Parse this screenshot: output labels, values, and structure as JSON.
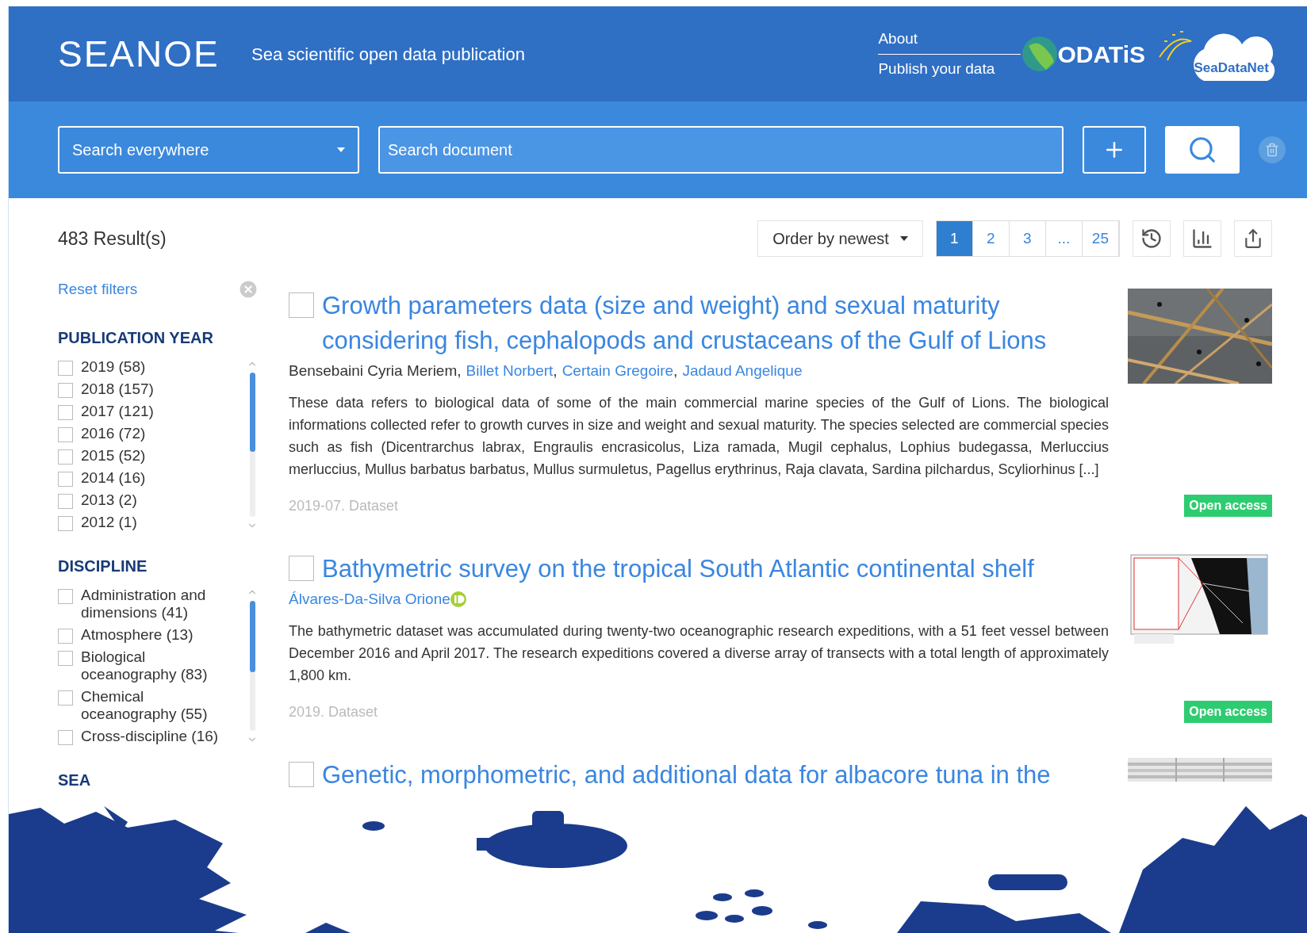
{
  "header": {
    "logo": "SEANOE",
    "tagline": "Sea scientific open data publication",
    "links": [
      "About",
      "Publish your data"
    ],
    "partner_logos": [
      "ODATiS",
      "SeaDataNet"
    ]
  },
  "search": {
    "scope": "Search everywhere",
    "placeholder": "Search document"
  },
  "results_count": "483 Result(s)",
  "reset_filters": "Reset filters",
  "facets": [
    {
      "title": "PUBLICATION YEAR",
      "items": [
        {
          "label": "2019 (58)",
          "checked": false
        },
        {
          "label": "2018 (157)",
          "checked": false
        },
        {
          "label": "2017 (121)",
          "checked": false
        },
        {
          "label": "2016 (72)",
          "checked": false
        },
        {
          "label": "2015 (52)",
          "checked": false
        },
        {
          "label": "2014 (16)",
          "checked": false
        },
        {
          "label": "2013 (2)",
          "checked": false
        },
        {
          "label": "2012 (1)",
          "checked": false
        }
      ]
    },
    {
      "title": "DISCIPLINE",
      "items": [
        {
          "label": "Administration and dimensions (41)",
          "checked": false
        },
        {
          "label": "Atmosphere (13)",
          "checked": false
        },
        {
          "label": "Biological oceanography (83)",
          "checked": false
        },
        {
          "label": "Chemical oceanography (55)",
          "checked": false
        },
        {
          "label": "Cross-discipline (16)",
          "checked": false
        }
      ]
    },
    {
      "title": "SEA"
    }
  ],
  "sort": "Order by newest",
  "pages": [
    {
      "label": "1",
      "selected": true
    },
    {
      "label": "2",
      "selected": false
    },
    {
      "label": "3",
      "selected": false
    },
    {
      "label": "...",
      "selected": false
    },
    {
      "label": "25",
      "selected": false
    }
  ],
  "results": [
    {
      "checked": false,
      "title": "Growth parameters data (size and weight) and sexual maturity considering fish, cephalopods and crustaceans of the Gulf of Lions",
      "thumbnail": {
        "kind": "picture"
      },
      "authors": [
        {
          "name": "Bensebaini Cyria Meriem",
          "kind": "plain",
          "orcid": false,
          "separator": ","
        },
        {
          "name": "Billet Norbert",
          "kind": "link",
          "orcid": false,
          "separator": ","
        },
        {
          "name": "Certain Gregoire",
          "kind": "link",
          "orcid": false,
          "separator": ","
        },
        {
          "name": "Jadaud Angelique",
          "kind": "link",
          "orcid": false
        }
      ],
      "description": "These data refers to biological data of some of the main commercial marine species of the Gulf of Lions. The biological informations collected refer to growth curves in size and weight and sexual maturity. The species selected are commercial species such as fish (Dicentrarchus labrax, Engraulis encrasicolus, Liza ramada, Mugil cephalus, Lophius budegassa, Merluccius merluccius, Mullus barbatus barbatus, Mullus surmuletus, Pagellus erythrinus, Raja clavata, Sardina pilchardus, Scyliorhinus [...]",
      "meta": "2019-07. Dataset",
      "access": "Open access"
    },
    {
      "checked": false,
      "title": "Bathymetric survey on the tropical South Atlantic continental shelf",
      "thumbnail": {
        "kind": "picture"
      },
      "authors": [
        {
          "name": "Álvares-Da-Silva Orione",
          "kind": "link",
          "orcid": true
        }
      ],
      "description": "The bathymetric dataset was accumulated during twenty-two oceanographic research expeditions, with a 51 feet vessel between December 2016 and April 2017. The research expeditions covered a diverse array of transects with a total length of approximately 1,800 km.",
      "meta": "2019. Dataset",
      "access": "Open access"
    },
    {
      "checked": false,
      "title": "Genetic, morphometric, and additional data for albacore tuna in the",
      "thumbnail": {
        "kind": "picture"
      }
    }
  ]
}
